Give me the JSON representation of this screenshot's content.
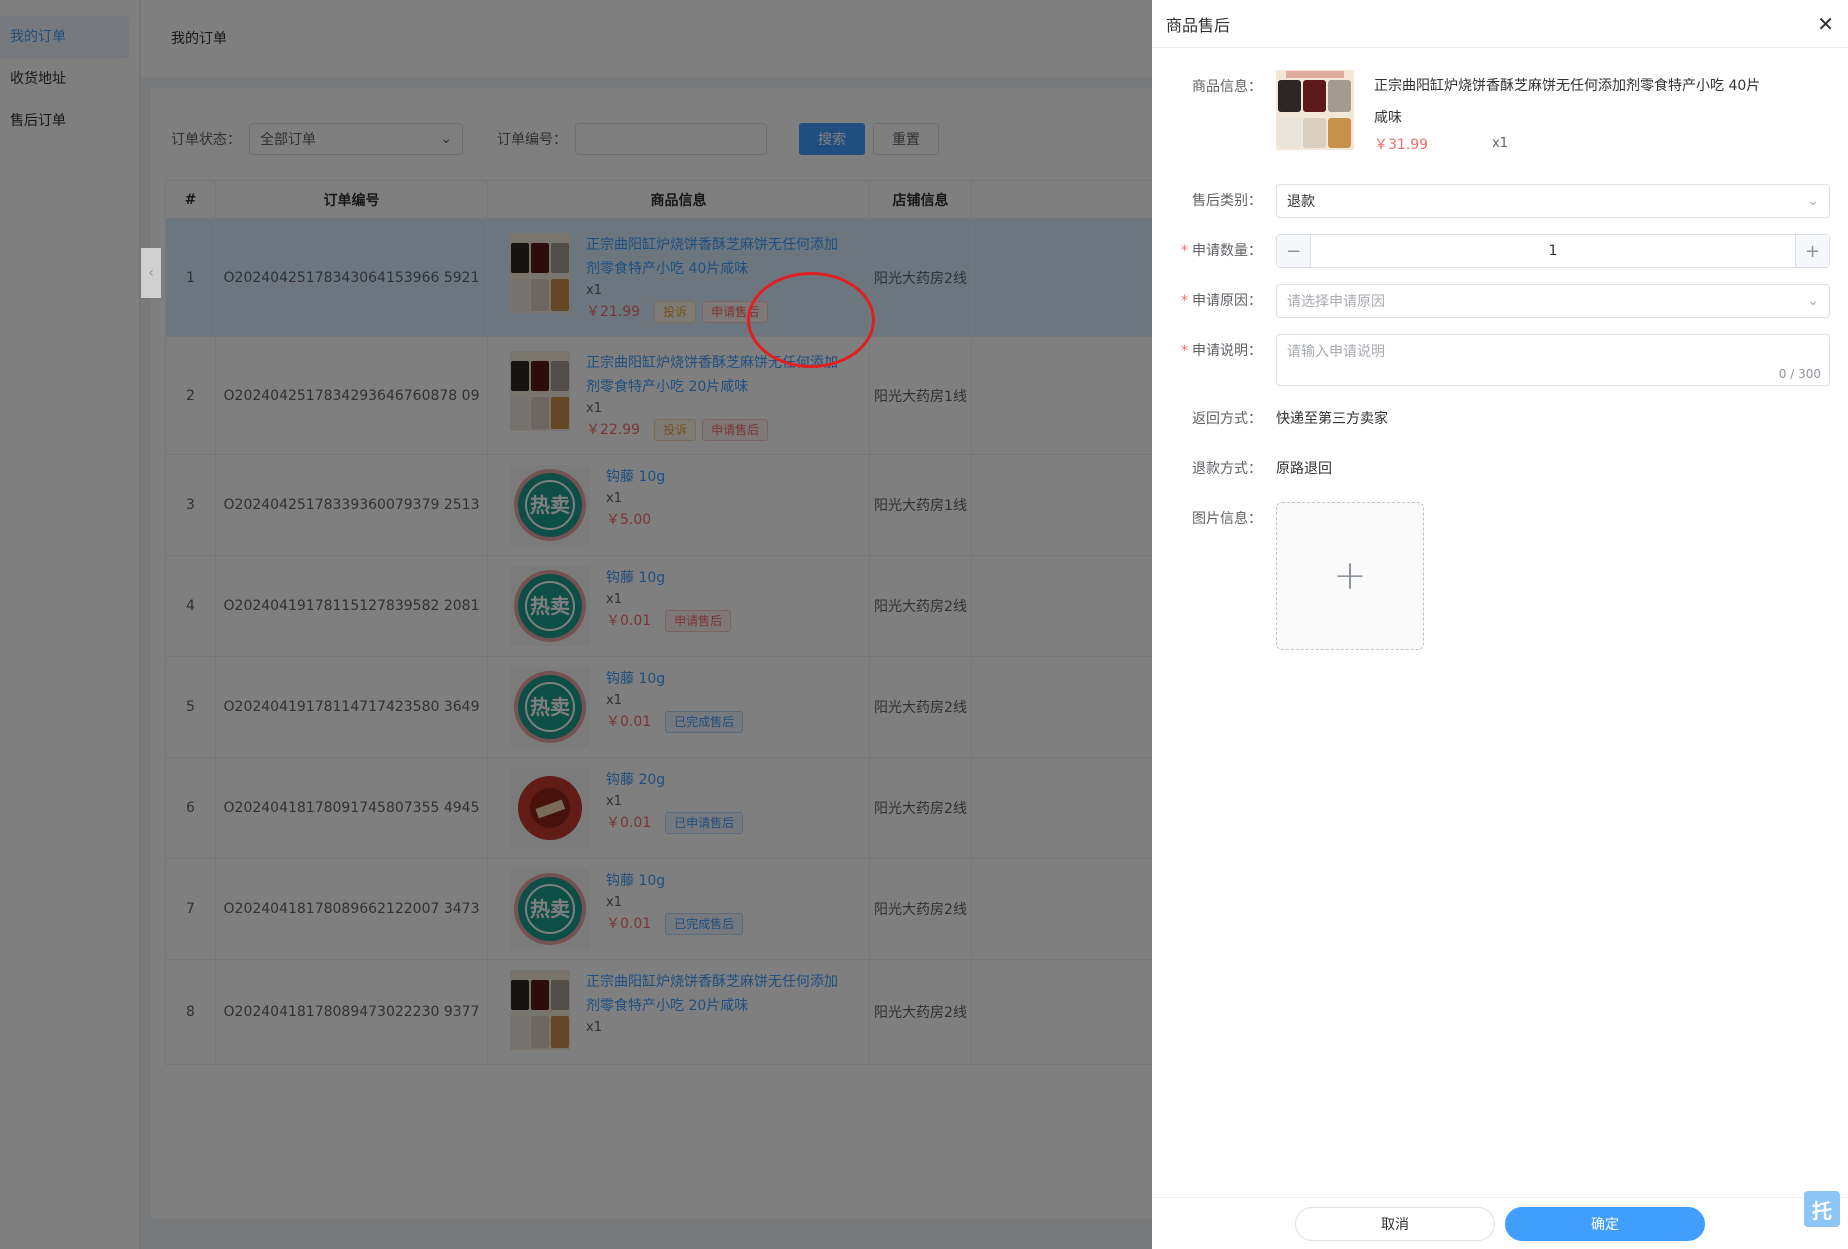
{
  "sidebar": {
    "items": [
      {
        "label": "我的订单"
      },
      {
        "label": "收货地址"
      },
      {
        "label": "售后订单"
      }
    ]
  },
  "header": {
    "title": "我的订单"
  },
  "filters": {
    "status_label": "订单状态：",
    "status_value": "全部订单",
    "order_no_label": "订单编号：",
    "order_no_value": "",
    "search_button": "搜索",
    "reset_button": "重置"
  },
  "table": {
    "columns": [
      "#",
      "订单编号",
      "商品信息",
      "店铺信息"
    ],
    "rows": [
      {
        "index": "1",
        "order_no": "O20240425178343064153966 5921",
        "product": "正宗曲阳缸炉烧饼香酥芝麻饼无任何添加剂零食特产小吃 40片咸味",
        "qty": "x1",
        "price": "￥21.99",
        "tags": [
          "投诉",
          "申请售后"
        ],
        "store": "阳光大药房2线",
        "thumb": "bread"
      },
      {
        "index": "2",
        "order_no": "O2024042517834293646760878 09",
        "product": "正宗曲阳缸炉烧饼香酥芝麻饼无任何添加剂零食特产小吃 20片咸味",
        "qty": "x1",
        "price": "￥22.99",
        "tags": [
          "投诉",
          "申请售后"
        ],
        "store": "阳光大药房1线",
        "thumb": "bread"
      },
      {
        "index": "3",
        "order_no": "O20240425178339360079379 2513",
        "product": "钩藤 10g",
        "qty": "x1",
        "price": "￥5.00",
        "tags": [],
        "store": "阳光大药房1线",
        "thumb": "hot"
      },
      {
        "index": "4",
        "order_no": "O20240419178115127839582 2081",
        "product": "钩藤 10g",
        "qty": "x1",
        "price": "￥0.01",
        "tags": [
          "申请售后"
        ],
        "store": "阳光大药房2线",
        "thumb": "hot"
      },
      {
        "index": "5",
        "order_no": "O20240419178114717423580 3649",
        "product": "钩藤 10g",
        "qty": "x1",
        "price": "￥0.01",
        "tags": [
          "已完成售后"
        ],
        "store": "阳光大药房2线",
        "thumb": "hot"
      },
      {
        "index": "6",
        "order_no": "O20240418178091745807355 4945",
        "product": "钩藤 20g",
        "qty": "x1",
        "price": "￥0.01",
        "tags": [
          "已申请售后"
        ],
        "store": "阳光大药房2线",
        "thumb": "red"
      },
      {
        "index": "7",
        "order_no": "O20240418178089662122007 3473",
        "product": "钩藤 10g",
        "qty": "x1",
        "price": "￥0.01",
        "tags": [
          "已完成售后"
        ],
        "store": "阳光大药房2线",
        "thumb": "hot"
      },
      {
        "index": "8",
        "order_no": "O20240418178089473022230 9377",
        "product": "正宗曲阳缸炉烧饼香酥芝麻饼无任何添加剂零食特产小吃 20片咸味",
        "qty": "x1",
        "price": "",
        "tags": [],
        "store": "阳光大药房2线",
        "thumb": "bread"
      }
    ]
  },
  "drawer": {
    "title": "商品售后",
    "product_label": "商品信息：",
    "product_name": "正宗曲阳缸炉烧饼香酥芝麻饼无任何添加剂零食特产小吃 40片咸味",
    "product_price": "￥31.99",
    "product_qty": "x1",
    "type_label": "售后类别：",
    "type_value": "退款",
    "qty_label": "申请数量：",
    "qty_value": "1",
    "qty_minus": "−",
    "qty_plus": "+",
    "reason_label": "申请原因：",
    "reason_placeholder": "请选择申请原因",
    "desc_label": "申请说明：",
    "desc_placeholder": "请输入申请说明",
    "desc_count": "0 / 300",
    "return_label": "返回方式：",
    "return_value": "快递至第三方卖家",
    "refund_label": "退款方式：",
    "refund_value": "原路退回",
    "image_label": "图片信息：",
    "upload_plus": "+",
    "cancel_button": "取消",
    "confirm_button": "确定",
    "float_button": "托"
  },
  "colors": {
    "primary": "#409eff",
    "danger": "#f56c6c",
    "warning": "#e6a23c",
    "hot_badge": "#1a9e8f"
  }
}
